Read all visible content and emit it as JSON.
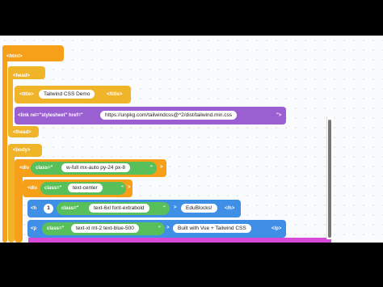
{
  "blocks": {
    "html_open": "<html>",
    "head_open": "<head>",
    "title_open": "<title>",
    "title_text": "Tailwind CSS Demo",
    "title_close": "</title>",
    "link_tag": "<link rel=\"stylesheet\" href=\"",
    "link_url": "https://unpkg.com/tailwindcss@^2/dist/tailwind.min.css",
    "link_end": "\">",
    "head_close": "</head>",
    "body_open": "<body>",
    "div_open": "<div",
    "class_attr": "class=\"",
    "div_class_value": "w-full mx-auto py-24 px-8",
    "close_quote": "\"",
    "gt": ">",
    "div2_class_value": "text-center",
    "h_open": "<h",
    "h_level": "1",
    "h_class_value": "text-6xl font-extrabold",
    "h_text": "EduBlocks!",
    "h_close": "</h>",
    "p_open": "<p",
    "p_class_value": "text-xl mt-2 text-blue-500",
    "p_text": "Built with Vue + Tailwind CSS",
    "p_close": "</p>"
  },
  "colors": {
    "html_block": "#f5a018",
    "head_block": "#f0b429",
    "link_block": "#9a5fd0",
    "div_block": "#f5a018",
    "heading_block": "#3f8fe6",
    "class_block": "#58c05a"
  }
}
